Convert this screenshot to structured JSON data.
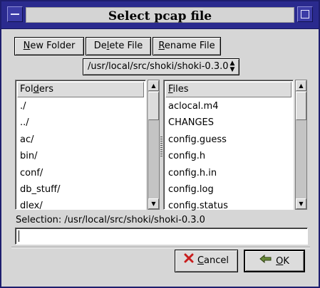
{
  "window": {
    "title": "Select pcap file"
  },
  "toolbar": {
    "new_folder": {
      "accel": "N",
      "rest": "ew Folder"
    },
    "delete_file": {
      "pre": "De",
      "accel": "l",
      "rest": "ete File"
    },
    "rename_file": {
      "accel": "R",
      "rest": "ename File"
    }
  },
  "path_selector": {
    "value": "/usr/local/src/shoki/shoki-0.3.0"
  },
  "folders": {
    "header_pre": "Fol",
    "header_accel": "d",
    "header_rest": "ers",
    "items": [
      "./",
      "../",
      "ac/",
      "bin/",
      "conf/",
      "db_stuff/",
      "dlex/"
    ]
  },
  "files": {
    "header_accel": "F",
    "header_rest": "iles",
    "items": [
      "aclocal.m4",
      "CHANGES",
      "config.guess",
      "config.h",
      "config.h.in",
      "config.log",
      "config.status"
    ]
  },
  "selection": {
    "label": "Selection: /usr/local/src/shoki/shoki-0.3.0",
    "entry_value": ""
  },
  "buttons": {
    "cancel": {
      "accel": "C",
      "rest": "ancel",
      "icon": "x-icon"
    },
    "ok": {
      "accel": "O",
      "rest": "K",
      "icon": "check-arrow-icon"
    }
  },
  "colors": {
    "titlebar": "#2a2a8e",
    "dialog_bg": "#d6d6d6"
  }
}
